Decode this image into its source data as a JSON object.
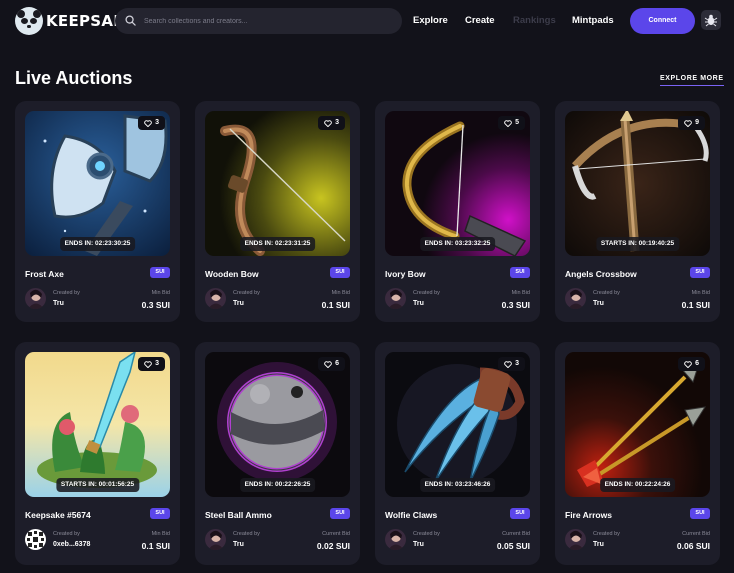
{
  "header": {
    "brand": "KEEPSAKE",
    "search_placeholder": "Search collections and creators...",
    "nav": [
      "Explore",
      "Create",
      "Rankings",
      "Mintpads"
    ],
    "connect_label": "Connect",
    "theme_icon": "bug-icon"
  },
  "section": {
    "title": "Live Auctions",
    "explore_label": "EXPLORE MORE"
  },
  "cards": [
    {
      "name": "Frost Axe",
      "likes": "3",
      "timer": "ENDS IN: 02:23:30:25",
      "badge": "SUI",
      "created_label": "Created by",
      "creator": "Tru",
      "bid_label": "Min Bid",
      "bid": "0.3 SUI"
    },
    {
      "name": "Wooden Bow",
      "likes": "3",
      "timer": "ENDS IN: 02:23:31:25",
      "badge": "SUI",
      "created_label": "Created by",
      "creator": "Tru",
      "bid_label": "Min Bid",
      "bid": "0.1 SUI"
    },
    {
      "name": "Ivory Bow",
      "likes": "5",
      "timer": "ENDS IN: 03:23:32:25",
      "badge": "SUI",
      "created_label": "Created by",
      "creator": "Tru",
      "bid_label": "Min Bid",
      "bid": "0.3 SUI"
    },
    {
      "name": "Angels Crossbow",
      "likes": "9",
      "timer": "STARTS IN: 00:19:40:25",
      "badge": "SUI",
      "created_label": "Created by",
      "creator": "Tru",
      "bid_label": "Min Bid",
      "bid": "0.1 SUI"
    },
    {
      "name": "Keepsake #5674",
      "likes": "3",
      "timer": "STARTS IN: 00:01:56:25",
      "badge": "SUI",
      "created_label": "Created by",
      "creator": "0xeb...6378",
      "bid_label": "Min Bid",
      "bid": "0.1 SUI"
    },
    {
      "name": "Steel Ball Ammo",
      "likes": "6",
      "timer": "ENDS IN: 00:22:26:25",
      "badge": "SUI",
      "created_label": "Created by",
      "creator": "Tru",
      "bid_label": "Current Bid",
      "bid": "0.02 SUI"
    },
    {
      "name": "Wolfie Claws",
      "likes": "3",
      "timer": "ENDS IN: 03:23:46:26",
      "badge": "SUI",
      "created_label": "Created by",
      "creator": "Tru",
      "bid_label": "Current Bid",
      "bid": "0.05 SUI"
    },
    {
      "name": "Fire Arrows",
      "likes": "6",
      "timer": "ENDS IN: 00:22:24:26",
      "badge": "SUI",
      "created_label": "Created by",
      "creator": "Tru",
      "bid_label": "Current Bid",
      "bid": "0.06 SUI"
    }
  ],
  "colors": {
    "accent": "#5b46ea",
    "background": "#12121a",
    "card": "#1d1d29"
  }
}
